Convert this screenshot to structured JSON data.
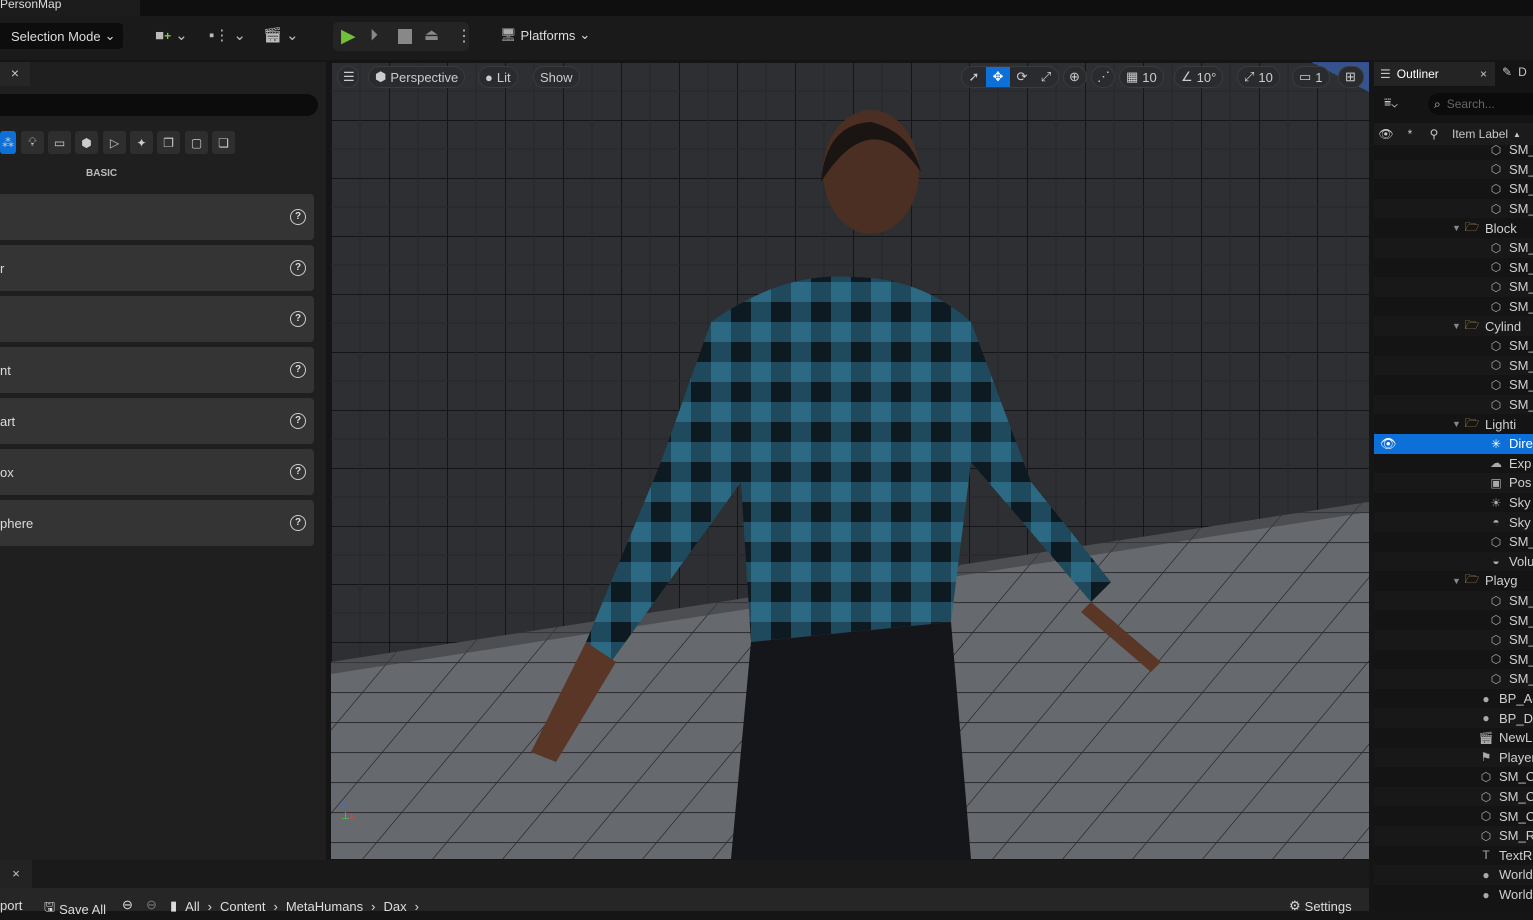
{
  "window": {
    "tab_title": "PersonMap"
  },
  "toolbar": {
    "selection_mode": "Selection Mode",
    "platforms": "Platforms"
  },
  "left_panel": {
    "close": "×",
    "category_label": "BASIC",
    "items": [
      {
        "label": ""
      },
      {
        "label": "r"
      },
      {
        "label": ""
      },
      {
        "label": "nt"
      },
      {
        "label": "art"
      },
      {
        "label": "ox"
      },
      {
        "label": "phere"
      }
    ]
  },
  "viewport": {
    "perspective": "Perspective",
    "lit": "Lit",
    "show": "Show",
    "grid_snap": "10",
    "rotation_snap": "10°",
    "scale_snap": "10",
    "camera_speed": "1",
    "accent": "#0d6fd8"
  },
  "outliner": {
    "title": "Outliner",
    "close": "×",
    "next_tab": "D",
    "search_placeholder": "Search...",
    "column": "Item Label",
    "rows": [
      {
        "label": "SM_",
        "icon": "mesh",
        "level": 2
      },
      {
        "label": "SM_",
        "icon": "mesh",
        "level": 2
      },
      {
        "label": "SM_",
        "icon": "mesh",
        "level": 2
      },
      {
        "label": "SM_",
        "icon": "mesh",
        "level": 2
      },
      {
        "label": "Block",
        "icon": "folder",
        "level": 1
      },
      {
        "label": "SM_",
        "icon": "mesh",
        "level": 2
      },
      {
        "label": "SM_",
        "icon": "mesh",
        "level": 2
      },
      {
        "label": "SM_",
        "icon": "mesh",
        "level": 2
      },
      {
        "label": "SM_",
        "icon": "mesh",
        "level": 2
      },
      {
        "label": "Cylind",
        "icon": "folder",
        "level": 1
      },
      {
        "label": "SM_",
        "icon": "mesh",
        "level": 2
      },
      {
        "label": "SM_",
        "icon": "mesh",
        "level": 2
      },
      {
        "label": "SM_",
        "icon": "mesh",
        "level": 2
      },
      {
        "label": "SM_",
        "icon": "mesh",
        "level": 2
      },
      {
        "label": "Lighti",
        "icon": "folder",
        "level": 1
      },
      {
        "label": "Dire",
        "icon": "directional-light",
        "level": 2,
        "selected": true
      },
      {
        "label": "Exp",
        "icon": "exponential-fog",
        "level": 2
      },
      {
        "label": "Pos",
        "icon": "post-process",
        "level": 2
      },
      {
        "label": "Sky",
        "icon": "sky-atmosphere",
        "level": 2
      },
      {
        "label": "Sky",
        "icon": "sky-light",
        "level": 2
      },
      {
        "label": "SM_",
        "icon": "mesh",
        "level": 2
      },
      {
        "label": "Volu",
        "icon": "volumetric-cloud",
        "level": 2
      },
      {
        "label": "Playg",
        "icon": "folder",
        "level": 1
      },
      {
        "label": "SM_",
        "icon": "mesh",
        "level": 2
      },
      {
        "label": "SM_",
        "icon": "mesh",
        "level": 2
      },
      {
        "label": "SM_",
        "icon": "mesh",
        "level": 2
      },
      {
        "label": "SM_",
        "icon": "mesh",
        "level": 2
      },
      {
        "label": "SM_",
        "icon": "mesh",
        "level": 2
      },
      {
        "label": "BP_Ac",
        "icon": "actor",
        "level": 0
      },
      {
        "label": "BP_Da",
        "icon": "actor",
        "level": 0
      },
      {
        "label": "NewL",
        "icon": "level-sequence",
        "level": 0
      },
      {
        "label": "Player",
        "icon": "player-start",
        "level": 0
      },
      {
        "label": "SM_C",
        "icon": "mesh",
        "level": 0
      },
      {
        "label": "SM_C",
        "icon": "mesh",
        "level": 0
      },
      {
        "label": "SM_C",
        "icon": "mesh",
        "level": 0
      },
      {
        "label": "SM_R",
        "icon": "mesh",
        "level": 0
      },
      {
        "label": "TextR",
        "icon": "text-render",
        "level": 0
      },
      {
        "label": "World",
        "icon": "actor",
        "level": 0
      },
      {
        "label": "World",
        "icon": "actor",
        "level": 0
      }
    ]
  },
  "bottom": {
    "close": "×",
    "import": "port",
    "save_all": "Save All",
    "breadcrumb": [
      "All",
      "Content",
      "MetaHumans",
      "Dax"
    ],
    "settings": "Settings"
  }
}
